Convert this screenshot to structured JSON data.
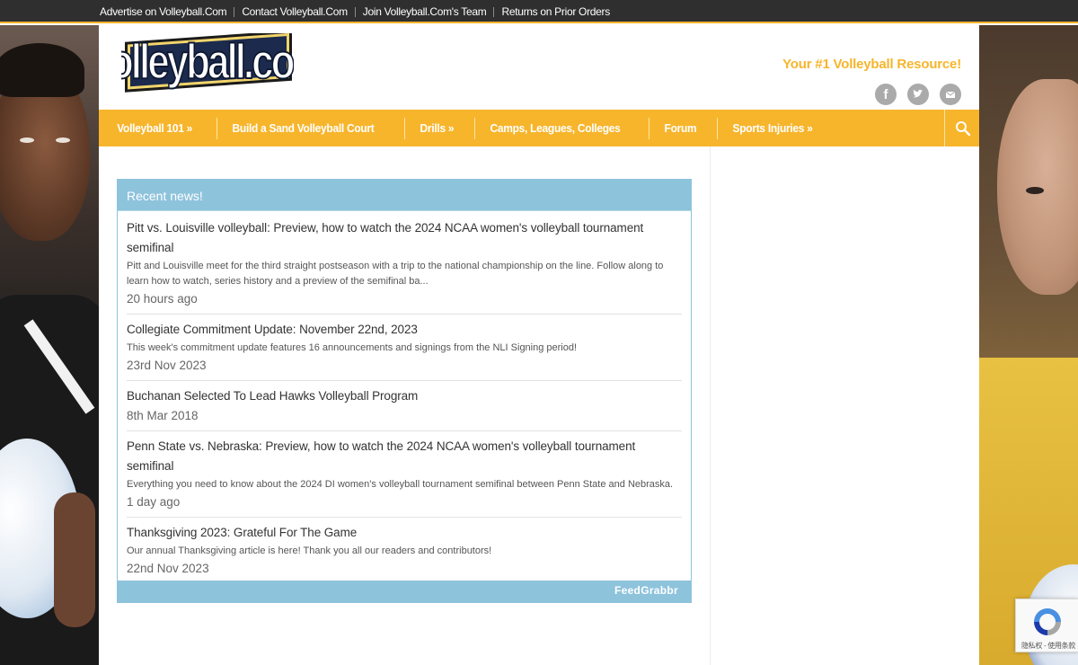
{
  "topbar": {
    "links": [
      "Advertise on Volleyball.Com",
      "Contact Volleyball.Com",
      "Join Volleyball.Com's Team",
      "Returns on Prior Orders"
    ]
  },
  "header": {
    "logo_text": "volleyball.com",
    "tagline": "Your #1 Volleyball Resource!",
    "social": [
      "facebook-icon",
      "twitter-icon",
      "email-icon"
    ]
  },
  "nav": {
    "items": [
      "Volleyball 101 »",
      "Build a Sand Volleyball Court",
      "Drills »",
      "Camps, Leagues, Colleges",
      "Forum",
      "Sports Injuries »"
    ]
  },
  "widget": {
    "title": "Recent news!",
    "footer": "FeedGrabbr",
    "items": [
      {
        "title": "Pitt vs. Louisville volleyball: Preview, how to watch the 2024 NCAA women's volleyball tournament semifinal",
        "desc": "Pitt and Louisville meet for the third straight postseason with a trip to the national championship on the line. Follow along to learn how to watch, series history and a preview of the semifinal ba...",
        "date": "20 hours ago"
      },
      {
        "title": "Collegiate Commitment Update: November 22nd, 2023",
        "desc": "This week's commitment update features 16 announcements and signings from the NLI Signing period!",
        "date": "23rd Nov 2023"
      },
      {
        "title": "Buchanan Selected To Lead Hawks Volleyball Program",
        "desc": "",
        "date": "8th Mar 2018"
      },
      {
        "title": "Penn State vs. Nebraska: Preview, how to watch the 2024 NCAA women's volleyball tournament semifinal",
        "desc": "Everything you need to know about the 2024 DI women's volleyball tournament semifinal between Penn State and Nebraska.",
        "date": "1 day ago"
      },
      {
        "title": "Thanksgiving 2023: Grateful For The Game",
        "desc": "Our annual Thanksgiving article is here! Thank you all our readers and contributors!",
        "date": "22nd Nov 2023"
      }
    ]
  },
  "recaptcha": {
    "text": "隐私权 - 使用条款"
  },
  "colors": {
    "accent": "#f7b52c",
    "widget_blue": "#8ec3dc",
    "topbar": "#2f2f2f"
  }
}
